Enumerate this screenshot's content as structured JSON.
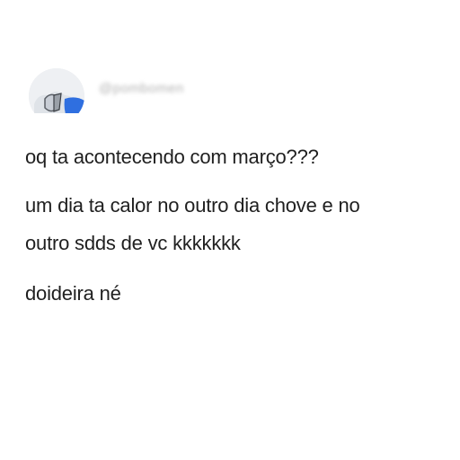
{
  "post": {
    "username": "@pombomen",
    "lines": [
      "oq ta acontecendo com março???",
      "um dia ta calor no outro dia chove e no",
      "outro sdds de vc kkkkkkk",
      "doideira né"
    ]
  },
  "colors": {
    "background": "#ffffff",
    "text": "#1f1f1f",
    "avatar_accent": "#2f6fe0"
  }
}
